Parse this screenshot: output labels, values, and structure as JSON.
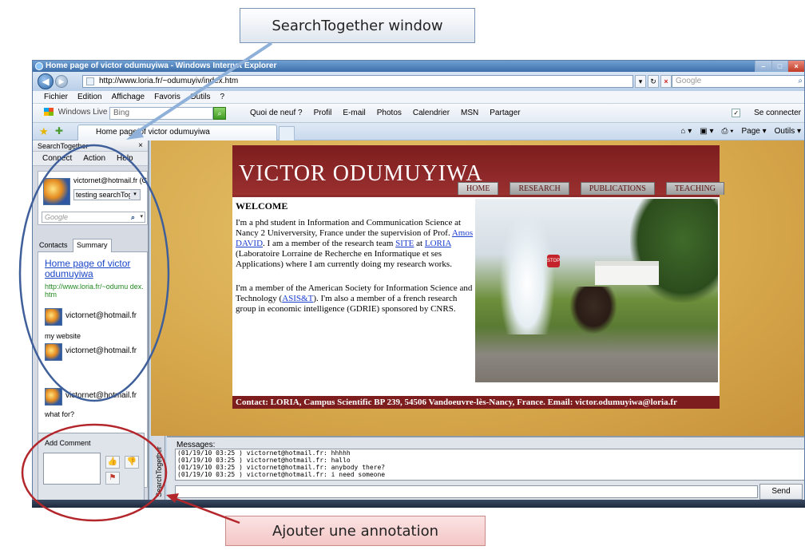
{
  "callouts": {
    "top": "SearchTogether window",
    "bottom": "Ajouter une annotation"
  },
  "browser": {
    "title": "Home page of victor odumuyiwa - Windows Internet Explorer",
    "address": "http://www.loria.fr/~odumuyiv/index.htm",
    "top_search_placeholder": "Google",
    "menu": [
      "Fichier",
      "Edition",
      "Affichage",
      "Favoris",
      "Outils",
      "?"
    ],
    "windows_live": "Windows Live",
    "bing_value": "Bing",
    "live_links": [
      "Quoi de neuf ?",
      "Profil",
      "E-mail",
      "Photos",
      "Calendrier",
      "MSN",
      "Partager"
    ],
    "connect_label": "Se connecter",
    "tab_title": "Home page of victor odumuyiwa",
    "command_page": "Page ▾",
    "command_tools": "Outils ▾"
  },
  "searchtogether": {
    "header": "SearchTogether",
    "close": "×",
    "menu": [
      "Connect",
      "Action",
      "Help"
    ],
    "user_email": "victornet@hotmail.fr (C",
    "status": "testing searchTog",
    "search_placeholder": "Google",
    "tabs": [
      "Contacts",
      "Summary"
    ],
    "summary_title": "Home page of victor odumuyiwa",
    "summary_url": "http://www.loria.fr/~odumu dex.htm",
    "entries": [
      {
        "email": "victornet@hotmail.fr",
        "note": "my website"
      },
      {
        "email": "victornet@hotmail.fr",
        "note": ""
      },
      {
        "email": "victornet@hotmail.fr",
        "note": "what for?"
      }
    ],
    "add_comment_label": "Add Comment"
  },
  "website": {
    "name": "VICTOR ODUMUYIWA",
    "nav": [
      "HOME",
      "RESEARCH",
      "PUBLICATIONS",
      "TEACHING"
    ],
    "welcome": "WELCOME",
    "para1_a": "I'm a phd student in Information and Communication Science at Nancy 2 Univerversity, France under the supervision of Prof. ",
    "para1_link1": "Amos DAVID",
    "para1_b": ". I am a member of the research team ",
    "para1_link2": "SITE",
    "para1_c": " at ",
    "para1_link3": "LORIA",
    "para1_d": " (Laboratoire Lorraine de Recherche en Informatique et ses Applications) where I am currently doing my research works.",
    "para2_a": "I'm a member of the American Society for Information Science and Technology (",
    "para2_link": "ASIS&T",
    "para2_b": "). I'm also a member of a french research group in economic intelligence (GDRIE) sponsored by CNRS.",
    "photo_stop": "STOP",
    "footer": "Contact: LORIA, Campus Scientific BP 239, 54506 Vandoeuvre-lès-Nancy, France. Email: victor.odumuyiwa@loria.fr"
  },
  "messages": {
    "label": "Messages:",
    "side_label": "SearchTogether",
    "lines": [
      "(01/19/10 03:25 ) victornet@hotmail.fr: hhhhh",
      "(01/19/10 03:25 ) victornet@hotmail.fr: hallo",
      "(01/19/10 03:25 ) victornet@hotmail.fr: anybody there?",
      "(01/19/10 03:25 ) victornet@hotmail.fr: i need someone"
    ],
    "send": "Send"
  },
  "colors": {
    "site_red": "#7d1d1d",
    "annotation_blue": "#3f5f9a",
    "annotation_red": "#b3262b"
  }
}
